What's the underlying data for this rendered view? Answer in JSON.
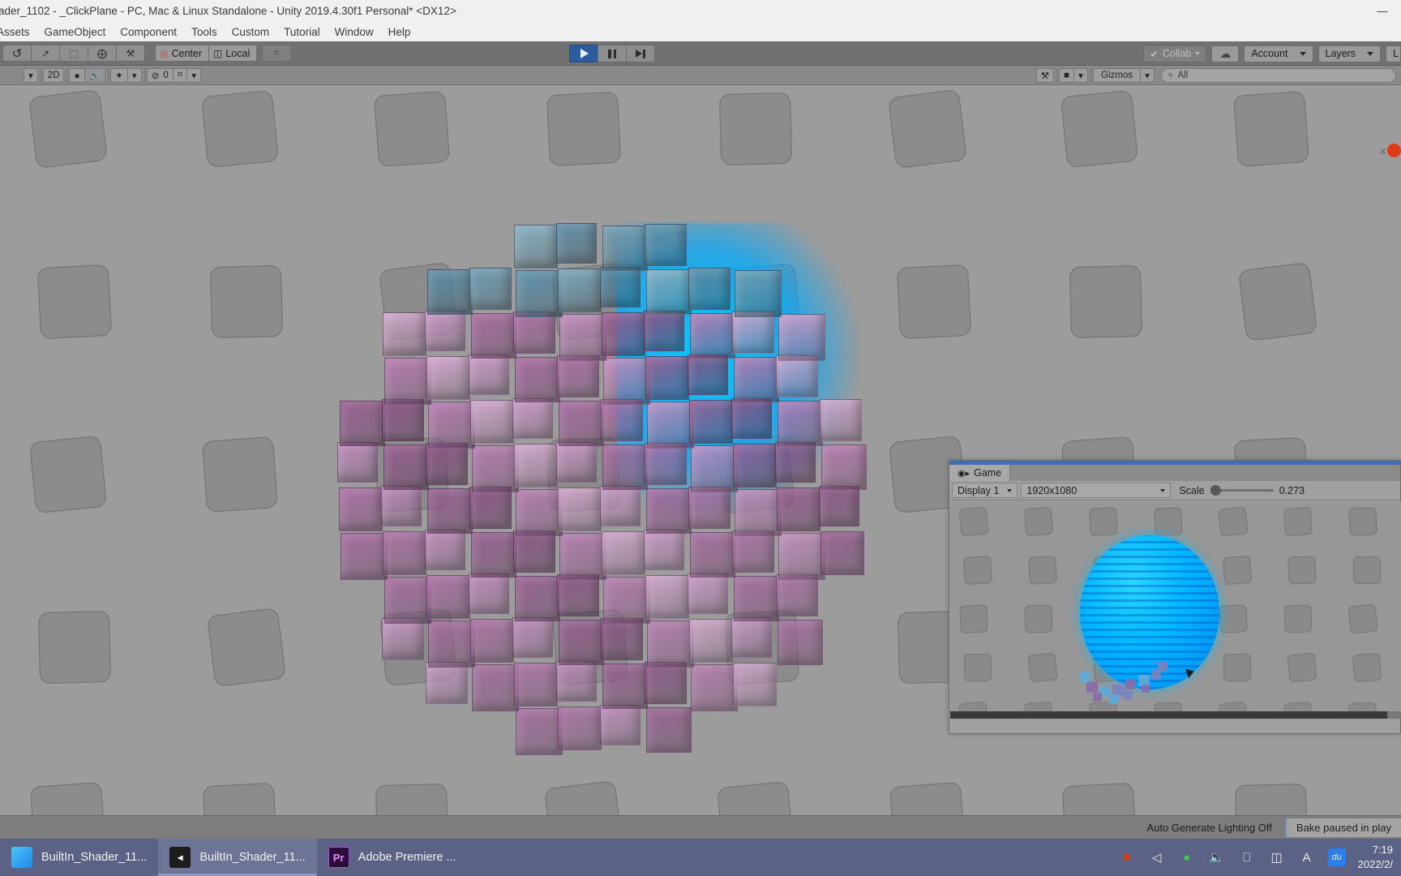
{
  "window": {
    "title": "ader_1102 - _ClickPlane - PC, Mac & Linux Standalone - Unity 2019.4.30f1 Personal* <DX12>",
    "minimize_icon": "—",
    "maximize_icon": "☐",
    "close_icon": "✕"
  },
  "menubar": {
    "items": [
      {
        "label": "Assets"
      },
      {
        "label": "GameObject"
      },
      {
        "label": "Component"
      },
      {
        "label": "Tools"
      },
      {
        "label": "Custom"
      },
      {
        "label": "Tutorial"
      },
      {
        "label": "Window"
      },
      {
        "label": "Help"
      }
    ]
  },
  "toolbar": {
    "tools": [
      {
        "name": "hand-tool",
        "glyph": "↺"
      },
      {
        "name": "move-tool",
        "glyph": "↗"
      },
      {
        "name": "rect-tool",
        "glyph": "⬚"
      },
      {
        "name": "scale-tool",
        "glyph": "⨁"
      },
      {
        "name": "custom-tool",
        "glyph": "⚒"
      }
    ],
    "pivot_mode": "Center",
    "pivot_rotation": "Local",
    "snap_label": "⌗",
    "play_label": "▶",
    "pause_label": "‖",
    "step_label": "▶|",
    "collab_label": "Collab",
    "cloud_label": "☁",
    "account_label": "Account",
    "layers_label": "Layers",
    "layout_label": "L"
  },
  "scene_toolbar": {
    "shading_caret": "▾",
    "mode_2d": "2D",
    "lighting_icon": "💡",
    "audio_icon": "🔊",
    "fx_icon": "✦",
    "fx_caret": "▾",
    "hidden_count": "0",
    "hidden_icon": "⊘",
    "grid_icon": "⌗",
    "grid_caret": "▾",
    "tools_icon": "⚒",
    "camera_icon": "■",
    "camera_caret": "▾",
    "gizmos_label": "Gizmos",
    "gizmos_caret": "▾",
    "search_icon": "⌕",
    "search_value": "All"
  },
  "scene": {
    "error_close": "x"
  },
  "game_panel": {
    "tab_label": "Game",
    "tab_icon": "gamepad-icon",
    "display_label": "Display 1",
    "resolution_label": "1920x1080",
    "scale_label": "Scale",
    "scale_value": "0.273"
  },
  "status_bar": {
    "lighting_status": "Auto Generate Lighting Off",
    "bake_status": "Bake paused in play"
  },
  "taskbar": {
    "items": [
      {
        "label": "BuiltIn_Shader_11...",
        "icon": "edge-icon",
        "active": false
      },
      {
        "label": "BuiltIn_Shader_11...",
        "icon": "unity-icon",
        "active": true
      },
      {
        "label": "Adobe Premiere ...",
        "icon": "premiere-icon",
        "active": false
      }
    ],
    "tray": [
      {
        "name": "record-icon",
        "glyph": "●"
      },
      {
        "name": "unity-tray-icon",
        "glyph": "◁"
      },
      {
        "name": "wechat-icon",
        "glyph": "●"
      },
      {
        "name": "volume-icon",
        "glyph": "🔊"
      },
      {
        "name": "display-icon",
        "glyph": "⬚"
      },
      {
        "name": "battery-icon",
        "glyph": "▭"
      },
      {
        "name": "ime-icon",
        "glyph": "A"
      },
      {
        "name": "baidu-icon",
        "glyph": "du"
      }
    ],
    "time": "7:19",
    "date": "2022/2/"
  },
  "colors": {
    "accent_blue": "#2b5c9e",
    "panel_gray": "#9c9c9c",
    "taskbar": "#5b6285",
    "sphere_cyan": "#00b5ff",
    "voxel_pink": "#c98fc0",
    "error_red": "#e03a15"
  }
}
